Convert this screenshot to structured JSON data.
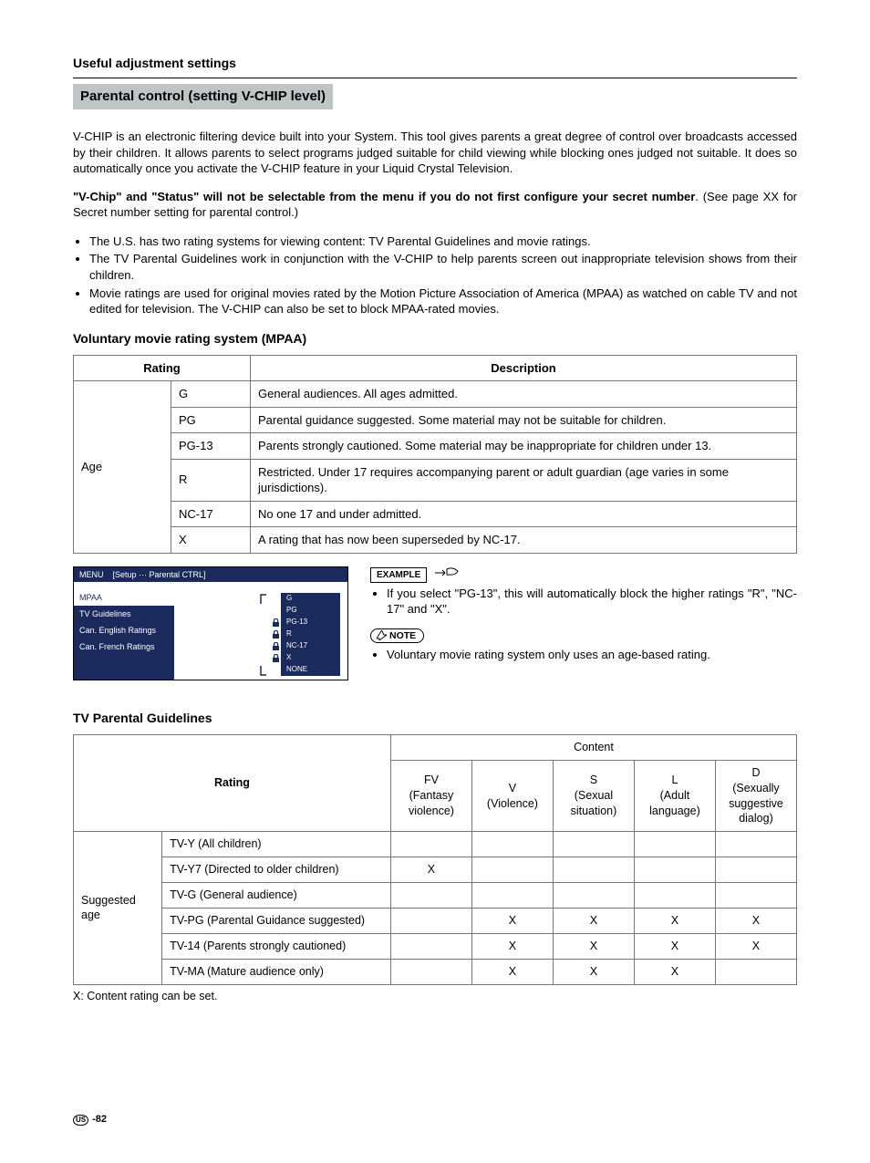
{
  "header": "Useful adjustment settings",
  "banner": "Parental control (setting V-CHIP level)",
  "intro_p1": "V-CHIP is an electronic filtering device built into your System. This tool gives parents a great degree of control over broadcasts accessed by their children. It allows parents to select programs judged suitable for child viewing while blocking ones judged not suitable. It does so automatically once you activate the V-CHIP feature in your Liquid Crystal Television.",
  "intro_bold": "\"V-Chip\" and \"Status\" will not be selectable from the menu if you do not first configure your secret number",
  "intro_tail": ". (See page XX for Secret number setting for parental control.)",
  "bullets": [
    "The U.S. has two rating systems for viewing content: TV Parental Guidelines and movie ratings.",
    "The TV Parental Guidelines work in conjunction with the V-CHIP to help parents screen out inappropriate television shows from their children.",
    "Movie ratings are used for original movies rated by the Motion Picture Association of America (MPAA) as watched on cable TV and not edited for television. The V-CHIP can also be set to block MPAA-rated movies."
  ],
  "mpaa_heading": "Voluntary movie rating system (MPAA)",
  "mpaa_head_rating": "Rating",
  "mpaa_head_desc": "Description",
  "mpaa_group": "Age",
  "mpaa_rows": [
    {
      "code": "G",
      "desc": "General audiences. All ages admitted."
    },
    {
      "code": "PG",
      "desc": "Parental guidance suggested. Some material may not be suitable for children."
    },
    {
      "code": "PG-13",
      "desc": "Parents strongly cautioned. Some material may be inappropriate for children under 13."
    },
    {
      "code": "R",
      "desc": "Restricted. Under 17 requires accompanying parent or adult guardian (age varies in some jurisdictions)."
    },
    {
      "code": "NC-17",
      "desc": "No one 17 and under admitted."
    },
    {
      "code": "X",
      "desc": "A rating that has now been superseded by NC-17."
    }
  ],
  "menu": {
    "title_left": "MENU",
    "title_right": "[Setup ··· Parental CTRL]",
    "left_items": [
      "MPAA",
      "TV Guidelines",
      "Can. English Ratings",
      "Can. French Ratings"
    ],
    "right_items": [
      {
        "label": "G",
        "lock": false,
        "cursor_top": true,
        "cursor_bot": false
      },
      {
        "label": "PG",
        "lock": false,
        "cursor_top": false,
        "cursor_bot": false
      },
      {
        "label": "PG-13",
        "lock": true,
        "cursor_top": false,
        "cursor_bot": false
      },
      {
        "label": "R",
        "lock": true,
        "cursor_top": false,
        "cursor_bot": false
      },
      {
        "label": "NC-17",
        "lock": true,
        "cursor_top": false,
        "cursor_bot": false
      },
      {
        "label": "X",
        "lock": true,
        "cursor_top": false,
        "cursor_bot": false
      },
      {
        "label": "NONE",
        "lock": false,
        "cursor_top": false,
        "cursor_bot": true
      }
    ]
  },
  "example_label": "EXAMPLE",
  "example_text": "If you select \"PG-13\", this will automatically block the higher ratings \"R\", \"NC-17\" and \"X\".",
  "note_label": "NOTE",
  "note_text": "Voluntary movie rating system only uses an age-based rating.",
  "tvpg_heading": "TV Parental Guidelines",
  "tvpg_head_rating": "Rating",
  "tvpg_head_content": "Content",
  "tvpg_cols": [
    {
      "top": "FV",
      "bot": "(Fantasy violence)"
    },
    {
      "top": "V",
      "bot": "(Violence)"
    },
    {
      "top": "S",
      "bot": "(Sexual situation)"
    },
    {
      "top": "L",
      "bot": "(Adult language)"
    },
    {
      "top": "D",
      "bot": "(Sexually suggestive dialog)"
    }
  ],
  "tvpg_group": "Suggested age",
  "tvpg_rows": [
    {
      "label": "TV-Y (All children)",
      "marks": [
        "",
        "",
        "",
        "",
        ""
      ]
    },
    {
      "label": "TV-Y7 (Directed to older children)",
      "marks": [
        "X",
        "",
        "",
        "",
        ""
      ]
    },
    {
      "label": "TV-G (General audience)",
      "marks": [
        "",
        "",
        "",
        "",
        ""
      ]
    },
    {
      "label": "TV-PG (Parental Guidance suggested)",
      "marks": [
        "",
        "X",
        "X",
        "X",
        "X"
      ]
    },
    {
      "label": "TV-14 (Parents strongly cautioned)",
      "marks": [
        "",
        "X",
        "X",
        "X",
        "X"
      ]
    },
    {
      "label": "TV-MA (Mature audience only)",
      "marks": [
        "",
        "X",
        "X",
        "X",
        ""
      ]
    }
  ],
  "tvpg_footnote": "X: Content rating can be set.",
  "page_number": "-82"
}
